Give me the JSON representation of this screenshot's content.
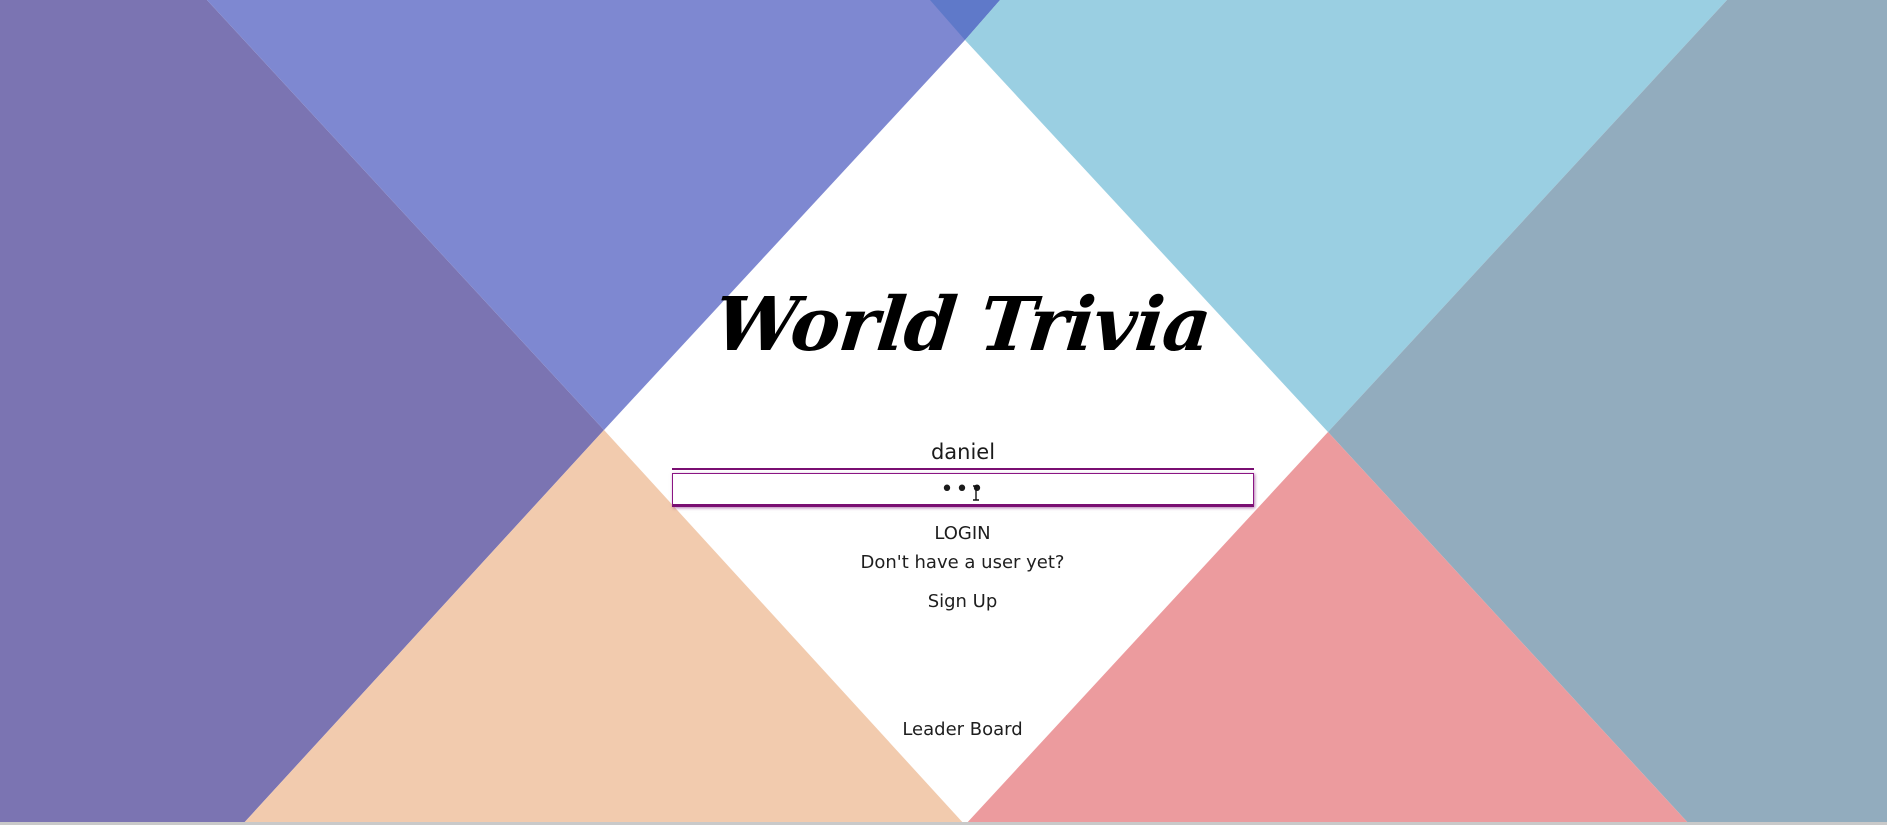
{
  "app": {
    "title": "World Trivia"
  },
  "login_form": {
    "username_value": "daniel",
    "password_value": "•••",
    "login_label": "LOGIN",
    "signup_prompt": "Don't have a user yet?",
    "signup_label": "Sign Up"
  },
  "footer": {
    "leaderboard_label": "Leader Board"
  },
  "background": {
    "colors": {
      "left_purple": "#7b74b2",
      "top_blue": "#7e88d1",
      "top_corner": "#5f79c9",
      "top_right_sky": "#9acfe2",
      "right_grey_blue": "#92acbe",
      "bottom_peach": "#f2cbae",
      "bottom_pink": "#ec9b9e",
      "center": "#ffffff"
    }
  },
  "icons": {
    "text_cursor": "i-beam-cursor-icon"
  }
}
